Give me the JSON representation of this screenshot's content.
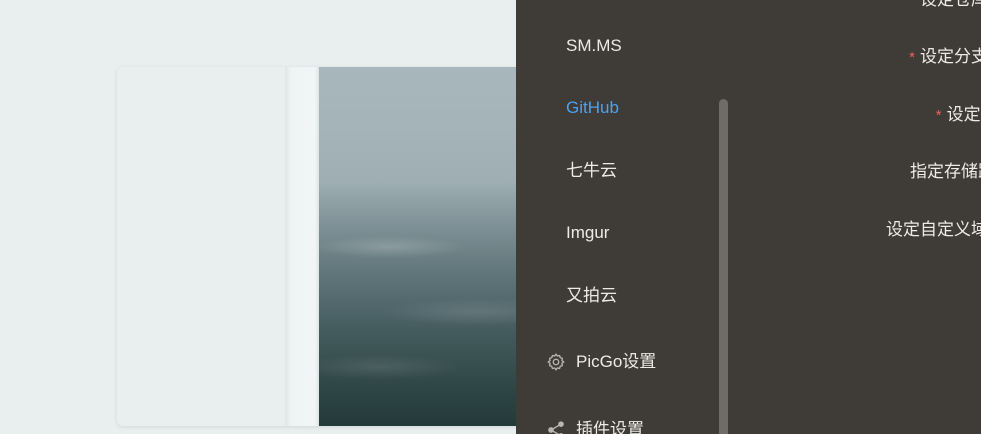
{
  "sidebar": {
    "items": [
      {
        "label": "SM.MS",
        "active": false
      },
      {
        "label": "GitHub",
        "active": true
      },
      {
        "label": "七牛云",
        "active": false
      },
      {
        "label": "Imgur",
        "active": false
      },
      {
        "label": "又拍云",
        "active": false
      }
    ],
    "menus": [
      {
        "label": "PicGo设置",
        "icon": "gear-icon"
      },
      {
        "label": "插件设置",
        "icon": "share-icon"
      }
    ]
  },
  "form": {
    "labels": [
      {
        "text": "设定仓库名",
        "required": true
      },
      {
        "text": "设定分支名",
        "required": true
      },
      {
        "text": "设定Token",
        "required": true
      },
      {
        "text": "指定存储路径",
        "required": false
      },
      {
        "text": "设定自定义域名",
        "required": false
      }
    ],
    "required_mark": "*"
  },
  "colors": {
    "panel_bg": "#3f3b37",
    "active": "#4aa2f2",
    "required": "#f06060"
  }
}
